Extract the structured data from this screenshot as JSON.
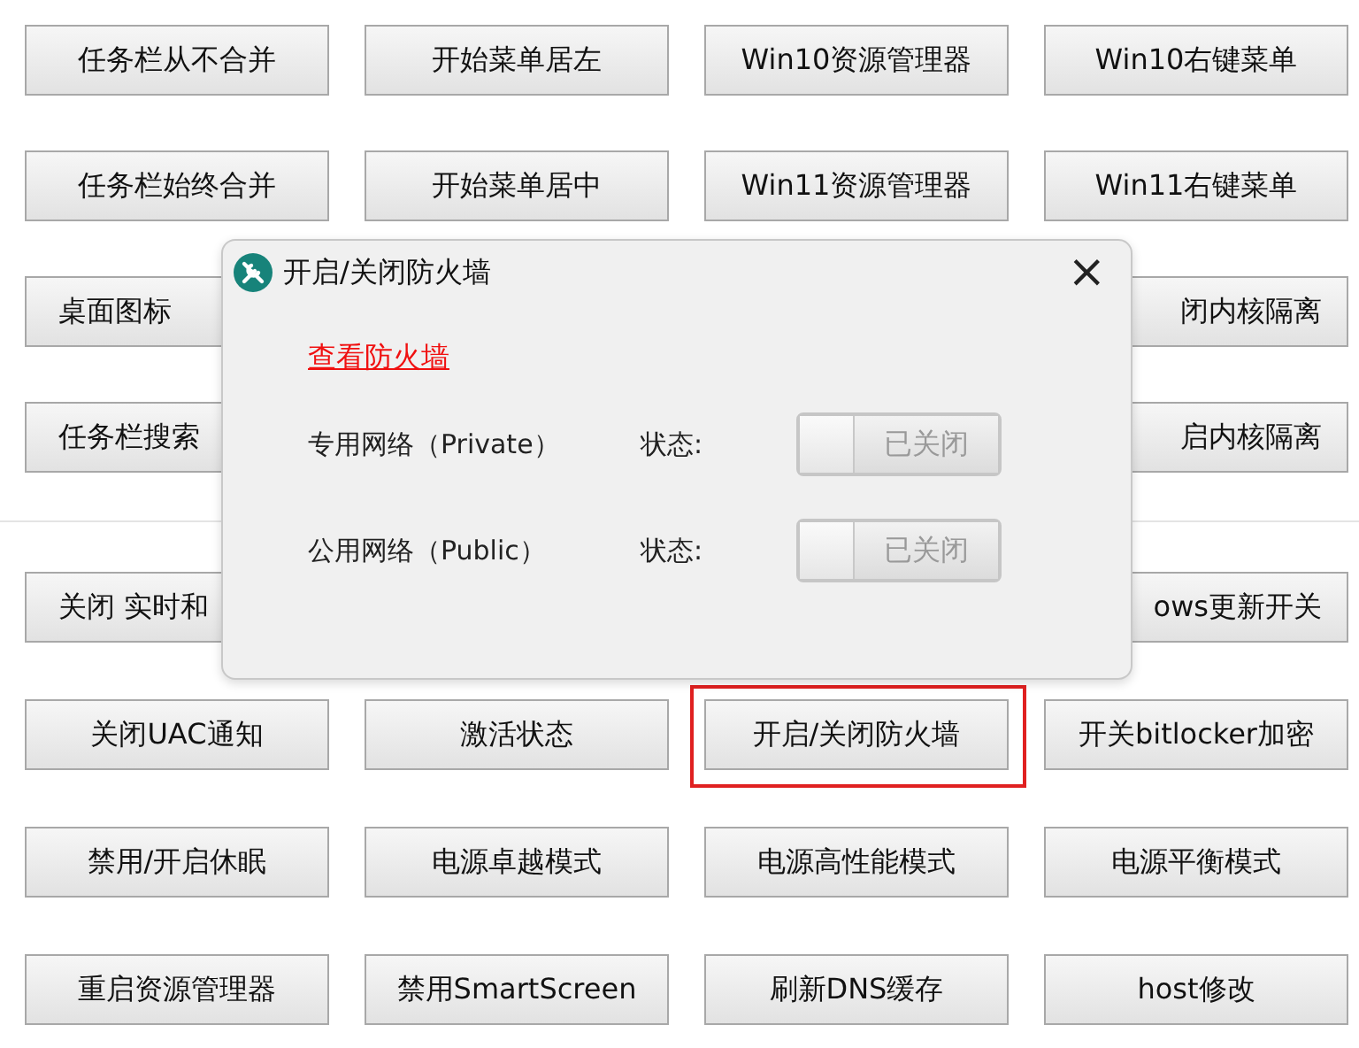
{
  "top_rows": [
    {
      "buttons": [
        {
          "label": "任务栏从不合并",
          "selected": false
        },
        {
          "label": "开始菜单居左",
          "selected": false
        },
        {
          "label": "Win10资源管理器",
          "selected": false
        },
        {
          "label": "Win10右键菜单",
          "selected": false
        }
      ]
    },
    {
      "buttons": [
        {
          "label": "任务栏始终合并",
          "selected": false
        },
        {
          "label": "开始菜单居中",
          "selected": false
        },
        {
          "label": "Win11资源管理器",
          "selected": false
        },
        {
          "label": "Win11右键菜单",
          "selected": false
        }
      ]
    },
    {
      "buttons": [
        {
          "label": "桌面图标",
          "selected": false
        },
        {
          "label": "闭内核隔离",
          "selected": false
        }
      ]
    },
    {
      "buttons": [
        {
          "label": "任务栏搜索",
          "selected": false
        },
        {
          "label": "启内核隔离",
          "selected": false
        }
      ]
    }
  ],
  "bottom_rows": [
    {
      "buttons": [
        {
          "label": "关闭 实时和",
          "selected": false
        },
        {
          "label": "ows更新开关",
          "selected": false
        }
      ]
    },
    {
      "buttons": [
        {
          "label": "关闭UAC通知",
          "selected": false
        },
        {
          "label": "激活状态",
          "selected": false
        },
        {
          "label": "开启/关闭防火墙",
          "selected": true
        },
        {
          "label": "开关bitlocker加密",
          "selected": false
        }
      ]
    },
    {
      "buttons": [
        {
          "label": "禁用/开启休眠",
          "selected": false
        },
        {
          "label": "电源卓越模式",
          "selected": false
        },
        {
          "label": "电源高性能模式",
          "selected": false
        },
        {
          "label": "电源平衡模式",
          "selected": false
        }
      ]
    },
    {
      "buttons": [
        {
          "label": "重启资源管理器",
          "selected": false
        },
        {
          "label": "禁用SmartScreen",
          "selected": false
        },
        {
          "label": "刷新DNS缓存",
          "selected": false
        },
        {
          "label": "host修改",
          "selected": false
        }
      ]
    }
  ],
  "dialog": {
    "title": "开启/关闭防火墙",
    "close": "×",
    "link": "查看防火墙",
    "networks": [
      {
        "label": "专用网络（Private）",
        "status_label": "状态:",
        "toggle_text": "已关闭",
        "on": false
      },
      {
        "label": "公用网络（Public）",
        "status_label": "状态:",
        "toggle_text": "已关闭",
        "on": false
      }
    ]
  }
}
